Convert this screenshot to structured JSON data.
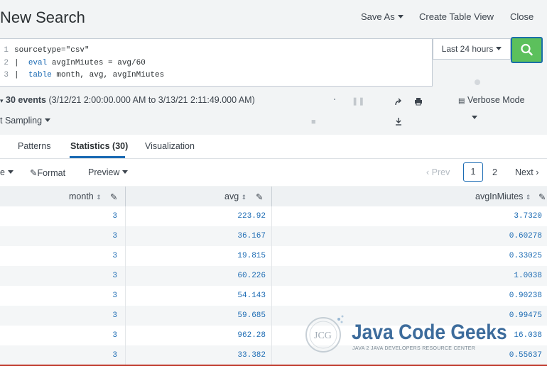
{
  "header": {
    "title": "New Search",
    "save_as": "Save As",
    "create_table_view": "Create Table View",
    "close": "Close"
  },
  "search": {
    "line_numbers": [
      "1",
      "2",
      "3"
    ],
    "line1": "sourcetype=\"csv\"",
    "line2_pipe": "| ",
    "line2_kw": "eval",
    "line2_rest": " avgInMiutes = avg/60",
    "line3_pipe": "| ",
    "line3_kw": "table",
    "line3_rest": " month, avg, avgInMiutes",
    "time_range": "Last 24 hours"
  },
  "status": {
    "events": "30 events",
    "range": "(3/12/21 2:00:00.000 AM to 3/13/21 2:11:49.000 AM)",
    "sampling": "t Sampling",
    "mode": "Verbose Mode"
  },
  "tabs": [
    "Patterns",
    "Statistics (30)",
    "Visualization"
  ],
  "toolbar": {
    "e_label": "e",
    "format": "Format",
    "preview": "Preview",
    "prev": "Prev",
    "page1": "1",
    "page2": "2",
    "next": "Next"
  },
  "table": {
    "columns": [
      "month",
      "avg",
      "avgInMiutes"
    ],
    "rows": [
      [
        "3",
        "223.92",
        "3.7320"
      ],
      [
        "3",
        "36.167",
        "0.60278"
      ],
      [
        "3",
        "19.815",
        "0.33025"
      ],
      [
        "3",
        "60.226",
        "1.0038"
      ],
      [
        "3",
        "54.143",
        "0.90238"
      ],
      [
        "3",
        "59.685",
        "0.99475"
      ],
      [
        "3",
        "962.28",
        "16.038"
      ],
      [
        "3",
        "33.382",
        "0.55637"
      ]
    ]
  },
  "watermark": {
    "logo_letters": "JCG",
    "name": "Java Code Geeks",
    "tagline": "JAVA 2 JAVA DEVELOPERS RESOURCE CENTER"
  },
  "colors": {
    "search_button": "#5cc05c",
    "link_blue": "#1a6ab3",
    "background": "#f2f4f5"
  },
  "icons": [
    "search-icon",
    "share-icon",
    "print-icon",
    "export-icon",
    "pause-icon",
    "stop-icon",
    "verbose-mode-icon",
    "pencil-icon",
    "sort-icon"
  ]
}
